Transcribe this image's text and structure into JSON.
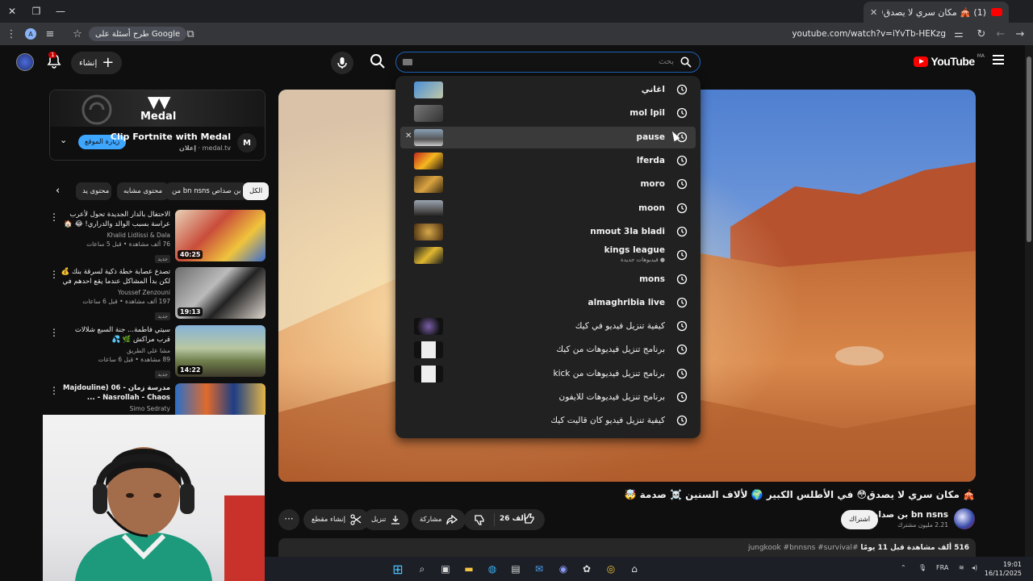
{
  "browser": {
    "tab_title": "(1) 🎪 مكان سري لا يصدق😳 في",
    "url": "youtube.com/watch?v=iYvTb-HEKzg",
    "google_chip": "طرح أسئلة على Google",
    "profile_initial": "A"
  },
  "header": {
    "logo_text": "YouTube",
    "country": "MA",
    "search_placeholder": "بحث",
    "create_label": "إنشاء",
    "notif_count": "1"
  },
  "ad": {
    "brand": "Medal",
    "title": "Clip Fortnite with Medal",
    "sponsor": "إعلان",
    "domain": "medal.tv",
    "visit_label": "زيارة الموقع"
  },
  "chips": [
    "الكل",
    "من bn nsns بن صداص",
    "محتوى مشابه",
    "محتوى يد"
  ],
  "related": [
    {
      "title": "الاحتفال بالدار الجديدة تحول لأعرب عراسة بسبب الوالد والدراري! 😂 🏠",
      "channel": "Khalid Lidlissi & Dala",
      "stats": "76 ألف مشاهدة • قبل 5 ساعات",
      "badge": "جديد",
      "duration": "40:25"
    },
    {
      "title": "تصدع عصابة خطة ذكية لسرقة بنك 💰 لكن بدأ المشاكل عندما يقع احدهم في حب مديرة...",
      "channel": "Youssef Zenzouni",
      "stats": "197 ألف مشاهدة • قبل 6 ساعات",
      "badge": "جديد",
      "duration": "19:13"
    },
    {
      "title": "سيتي فاطمة... جنة السبع شلالات قرب مراكش 🌿 💦",
      "channel": "مشا على الطريق",
      "stats": "89 مشاهدة • قبل 6 ساعات",
      "badge": "جديد",
      "duration": "14:22"
    },
    {
      "title": "مدرسة زمان - Majdouline) 06 Nasrollah - Chaos - ...",
      "channel": "Simo Sedraty",
      "stats": "",
      "badge": "",
      "duration": ""
    }
  ],
  "suggestions": [
    {
      "text": "اغاني",
      "sub": ""
    },
    {
      "text": "mol lpil",
      "sub": ""
    },
    {
      "text": "pause",
      "sub": ""
    },
    {
      "text": "lferda",
      "sub": ""
    },
    {
      "text": "moro",
      "sub": ""
    },
    {
      "text": "moon",
      "sub": ""
    },
    {
      "text": "nmout 3la bladi",
      "sub": ""
    },
    {
      "text": "kings league",
      "sub": "● فيديوهات جديدة"
    },
    {
      "text": "mons",
      "sub": ""
    },
    {
      "text": "almaghribia live",
      "sub": ""
    },
    {
      "text": "كيفية تنزيل فيديو في كيك",
      "sub": ""
    },
    {
      "text": "برنامج تنزيل فيديوهات من كيك",
      "sub": ""
    },
    {
      "text": "برنامج تنزيل فيديوهات من kick",
      "sub": ""
    },
    {
      "text": "برنامج تنزيل فيديوهات للايفون",
      "sub": ""
    },
    {
      "text": "كيفية تنزيل فيديو كان قاليت كيك",
      "sub": ""
    }
  ],
  "video": {
    "title": "🎪 مكان سري لا يصدق😳 في الأطلس الكبير 🌍 لألاف السنين ☠️ صدمة 🤯",
    "channel": "bn nsns بن صداص",
    "subscribers": "2.21 مليون مشترك",
    "subscribe_label": "اشتراك",
    "likes": "26 ألف",
    "share_label": "مشاركة",
    "download_label": "تنزيل",
    "clip_label": "إنشاء مقطع",
    "desc_stats": "516 ألف مشاهدة قبل 11 يومًا",
    "desc_tags": "#jungkook #bnnsns #survival"
  },
  "taskbar": {
    "lang": "FRA",
    "time": "19:01",
    "date": "16/11/2025"
  }
}
